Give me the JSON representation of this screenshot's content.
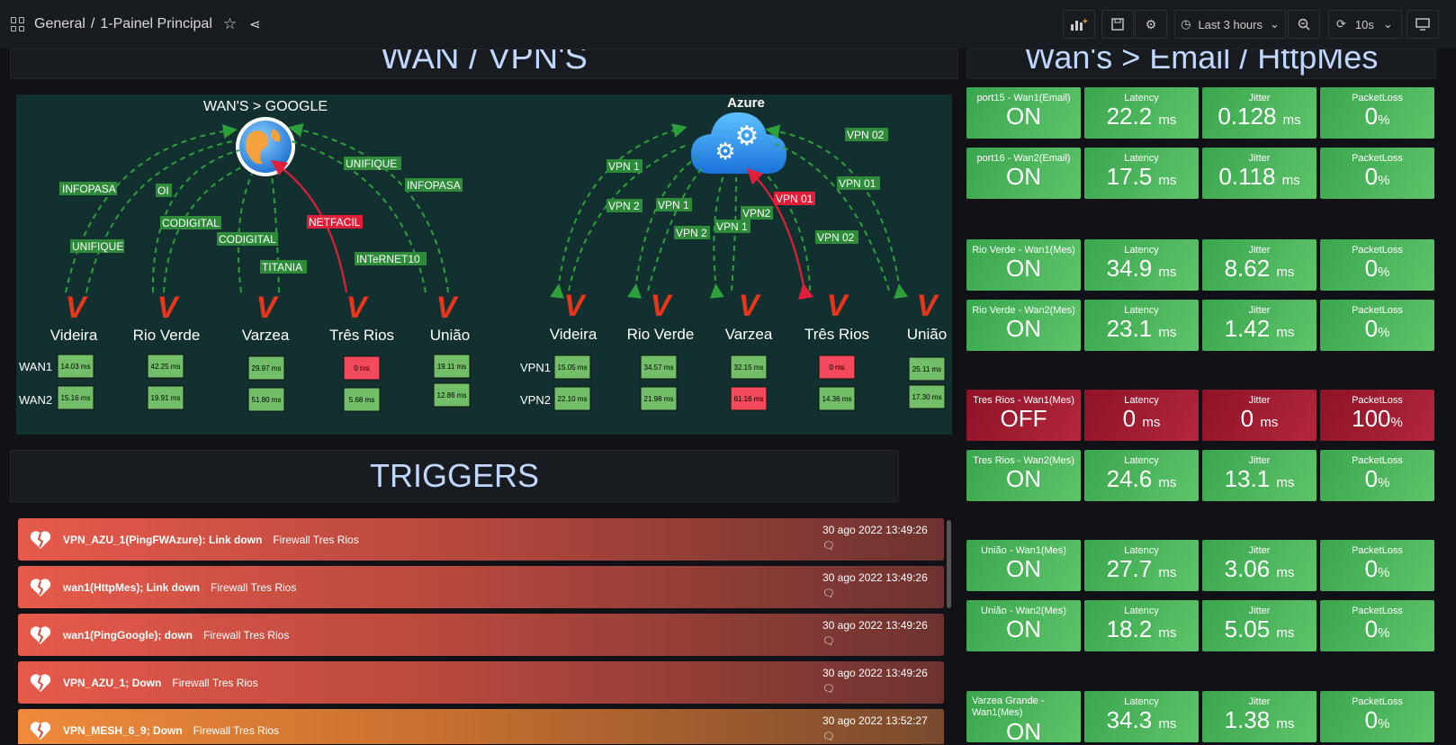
{
  "breadcrumb": {
    "folder": "General",
    "sep": "/",
    "dashboard": "1-Painel Principal"
  },
  "toolbar": {
    "time_range": "Last 3 hours",
    "refresh": "10s"
  },
  "headers": {
    "wan_vpn": "WAN / VPN'S",
    "wans_email": "Wan's > Email / HttpMes",
    "triggers": "TRIGGERS"
  },
  "map": {
    "google_title": "WAN'S > GOOGLE",
    "azure_title": "Azure",
    "wan_links": [
      "INFOPASA",
      "UNIFIQUE",
      "OI",
      "CODIGITAL",
      "CODIGITAL",
      "TITANIA",
      "NETFACIL",
      "INTeRNET10",
      "UNIFIQUE",
      "INFOPASA"
    ],
    "vpn_links": [
      "VPN 1",
      "VPN 2",
      "VPN 1",
      "VPN 2",
      "VPN2",
      "VPN 1",
      "VPN 01",
      "VPN 02",
      "VPN 01",
      "VPN 02"
    ],
    "row_labels_wan": [
      "WAN1",
      "WAN2"
    ],
    "row_labels_vpn": [
      "VPN1",
      "VPN2"
    ],
    "sites": [
      "Videira",
      "Rio Verde",
      "Varzea",
      "Três Rios",
      "União"
    ],
    "wan1": [
      "14.03 ms",
      "42.25 ms",
      "29.97 ms",
      "0 ms",
      "19.11 ms"
    ],
    "wan2": [
      "15.16 ms",
      "19.91 ms",
      "51.80 ms",
      "5.68 ms",
      "12.86 ms"
    ],
    "vpn1": [
      "15.05 ms",
      "34.57 ms",
      "32.15 ms",
      "0 ms",
      "25.11 ms"
    ],
    "vpn2": [
      "22.10 ms",
      "21.98 ms",
      "61.16 ms",
      "14.36 ms",
      "17.30 ms"
    ]
  },
  "stats": [
    {
      "name": "port15 - Wan1(Email)",
      "status": "ON",
      "latency": "22.2",
      "jitter": "0.128",
      "loss": "0",
      "state": "green"
    },
    {
      "name": "port16 - Wan2(Email)",
      "status": "ON",
      "latency": "17.5",
      "jitter": "0.118",
      "loss": "0",
      "state": "green"
    },
    {
      "name": "Rio Verde - Wan1(Mes)",
      "status": "ON",
      "latency": "34.9",
      "jitter": "8.62",
      "loss": "0",
      "state": "green"
    },
    {
      "name": "Rio Verde - Wan2(Mes)",
      "status": "ON",
      "latency": "23.1",
      "jitter": "1.42",
      "loss": "0",
      "state": "green"
    },
    {
      "name": "Tres Rios - Wan1(Mes)",
      "status": "OFF",
      "latency": "0",
      "jitter": "0",
      "loss": "100",
      "state": "red"
    },
    {
      "name": "Tres Rios - Wan2(Mes)",
      "status": "ON",
      "latency": "24.6",
      "jitter": "13.1",
      "loss": "0",
      "state": "green"
    },
    {
      "name": "União - Wan1(Mes)",
      "status": "ON",
      "latency": "27.7",
      "jitter": "3.06",
      "loss": "0",
      "state": "green"
    },
    {
      "name": "União - Wan2(Mes)",
      "status": "ON",
      "latency": "18.2",
      "jitter": "5.05",
      "loss": "0",
      "state": "green"
    },
    {
      "name": "Varzea Grande - Wan1(Mes)",
      "status": "ON",
      "latency": "34.3",
      "jitter": "1.38",
      "loss": "0",
      "state": "green"
    }
  ],
  "stat_labels": {
    "latency": "Latency",
    "jitter": "Jitter",
    "loss": "PacketLoss",
    "ms": "ms",
    "pct": "%"
  },
  "triggers": [
    {
      "name": "VPN_AZU_1(PingFWAzure): Link down",
      "host": "Firewall Tres Rios",
      "time": "30 ago 2022 13:49:26",
      "severity": "high"
    },
    {
      "name": "wan1(HttpMes); Link down",
      "host": "Firewall Tres Rios",
      "time": "30 ago 2022 13:49:26",
      "severity": "high"
    },
    {
      "name": "wan1(PingGoogle); down",
      "host": "Firewall Tres Rios",
      "time": "30 ago 2022 13:49:26",
      "severity": "high"
    },
    {
      "name": "VPN_AZU_1; Down",
      "host": "Firewall Tres Rios",
      "time": "30 ago 2022 13:49:26",
      "severity": "high"
    },
    {
      "name": "VPN_MESH_6_9; Down",
      "host": "Firewall Tres Rios",
      "time": "30 ago 2022 13:52:27",
      "severity": "average"
    }
  ],
  "colors": {
    "ok": "#2e8b3a",
    "alarm": "#e02f44",
    "value_ok": "#73bf69"
  }
}
